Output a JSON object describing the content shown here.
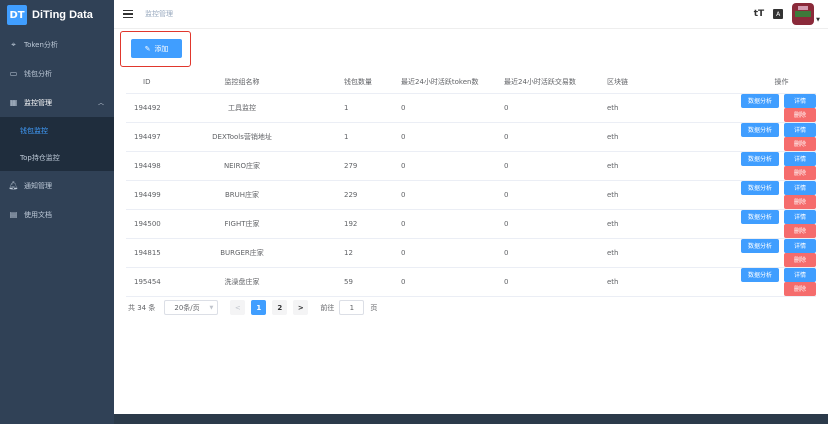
{
  "app": {
    "logo_badge": "DT",
    "logo_text": "DiTing Data"
  },
  "sidebar": {
    "items": [
      {
        "label": "Token分析",
        "icon": "crosshair-icon"
      },
      {
        "label": "钱包分析",
        "icon": "wallet-icon"
      },
      {
        "label": "监控管理",
        "icon": "grid-icon"
      },
      {
        "label": "通知管理",
        "icon": "bell-icon"
      },
      {
        "label": "使用文档",
        "icon": "doc-icon"
      }
    ],
    "sub_items": [
      {
        "label": "钱包监控"
      },
      {
        "label": "Top持仓监控"
      }
    ]
  },
  "header": {
    "breadcrumb": "监控管理",
    "font_size_icon": "tT",
    "translate_icon": "A"
  },
  "toolbar": {
    "add_label": "添加"
  },
  "table": {
    "headers": {
      "id": "ID",
      "name": "监控组名称",
      "count": "钱包数量",
      "token": "最近24小时活跃token数",
      "tx": "最近24小时活跃交易数",
      "chain": "区块链",
      "ops": "操作"
    },
    "rows": [
      {
        "id": "194492",
        "name": "工具监控",
        "count": "1",
        "token": "0",
        "tx": "0",
        "chain": "eth"
      },
      {
        "id": "194497",
        "name": "DEXTools营销地址",
        "count": "1",
        "token": "0",
        "tx": "0",
        "chain": "eth"
      },
      {
        "id": "194498",
        "name": "NEIRO庄家",
        "count": "279",
        "token": "0",
        "tx": "0",
        "chain": "eth"
      },
      {
        "id": "194499",
        "name": "BRUH庄家",
        "count": "229",
        "token": "0",
        "tx": "0",
        "chain": "eth"
      },
      {
        "id": "194500",
        "name": "FIGHT庄家",
        "count": "192",
        "token": "0",
        "tx": "0",
        "chain": "eth"
      },
      {
        "id": "194815",
        "name": "BURGER庄家",
        "count": "12",
        "token": "0",
        "tx": "0",
        "chain": "eth"
      },
      {
        "id": "195454",
        "name": "洗澡盘庄家",
        "count": "59",
        "token": "0",
        "tx": "0",
        "chain": "eth"
      }
    ],
    "ops": {
      "analysis": "数据分析",
      "detail": "详情",
      "delete": "删除"
    }
  },
  "pagination": {
    "total": "共 34 条",
    "page_size": "20条/页",
    "prev": "<",
    "pages": [
      "1",
      "2"
    ],
    "next": ">",
    "goto_prefix": "前往",
    "goto_value": "1",
    "goto_suffix": "页"
  },
  "colors": {
    "sidebar_bg": "#304156",
    "primary": "#409eff",
    "danger": "#f56c6c"
  }
}
